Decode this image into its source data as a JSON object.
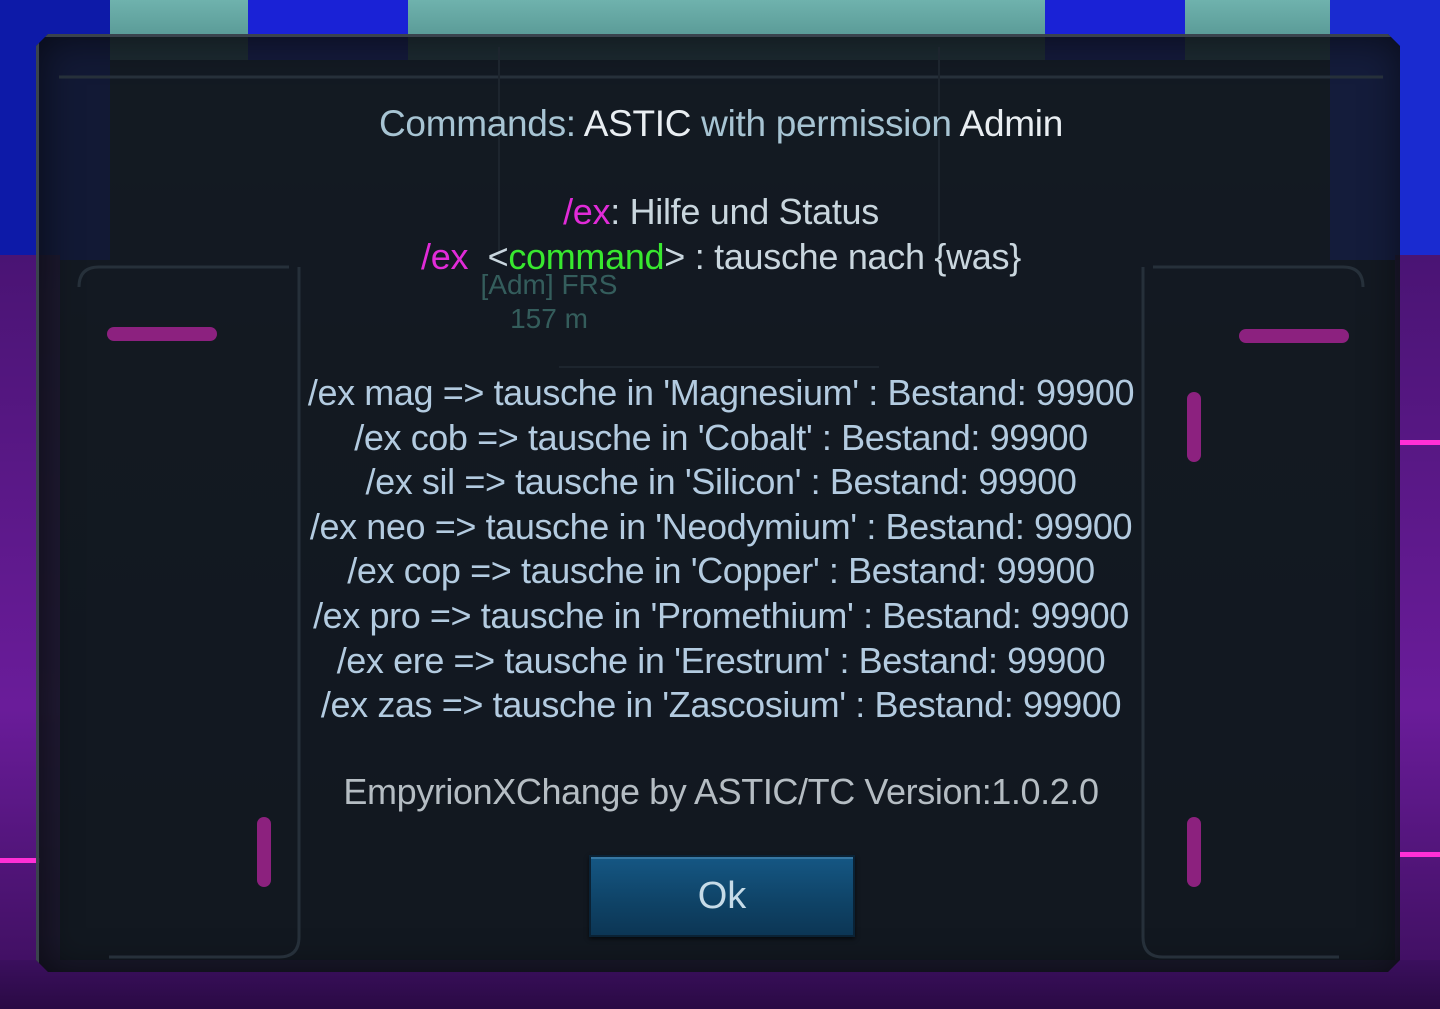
{
  "dialog": {
    "title_prefix": "Commands:",
    "title_user": "ASTIC",
    "title_mid": "with permission",
    "title_role": "Admin",
    "help": {
      "cmd": "/ex",
      "desc": ": Hilfe und Status"
    },
    "usage": {
      "cmd": "/ex",
      "open": "<",
      "arg": "command",
      "close": ">",
      "desc": ": tausche nach {was}"
    },
    "commands": [
      "/ex mag => tausche in 'Magnesium' : Bestand: 99900",
      "/ex cob => tausche in 'Cobalt' : Bestand: 99900",
      "/ex sil => tausche in 'Silicon' : Bestand: 99900",
      "/ex neo => tausche in 'Neodymium' : Bestand: 99900",
      "/ex cop => tausche in 'Copper' : Bestand: 99900",
      "/ex pro => tausche in 'Promethium' : Bestand: 99900",
      "/ex ere => tausche in 'Erestrum' : Bestand: 99900",
      "/ex zas => tausche in 'Zascosium' : Bestand: 99900"
    ],
    "footer": "EmpyrionXChange by ASTIC/TC Version:1.0.2.0",
    "ok_label": "Ok"
  },
  "background_hud": {
    "label": "[Adm] FRS",
    "distance": "157 m"
  },
  "colors": {
    "command_magenta": "#e12bd8",
    "arg_green": "#38e82f",
    "button_blue": "#155784"
  }
}
